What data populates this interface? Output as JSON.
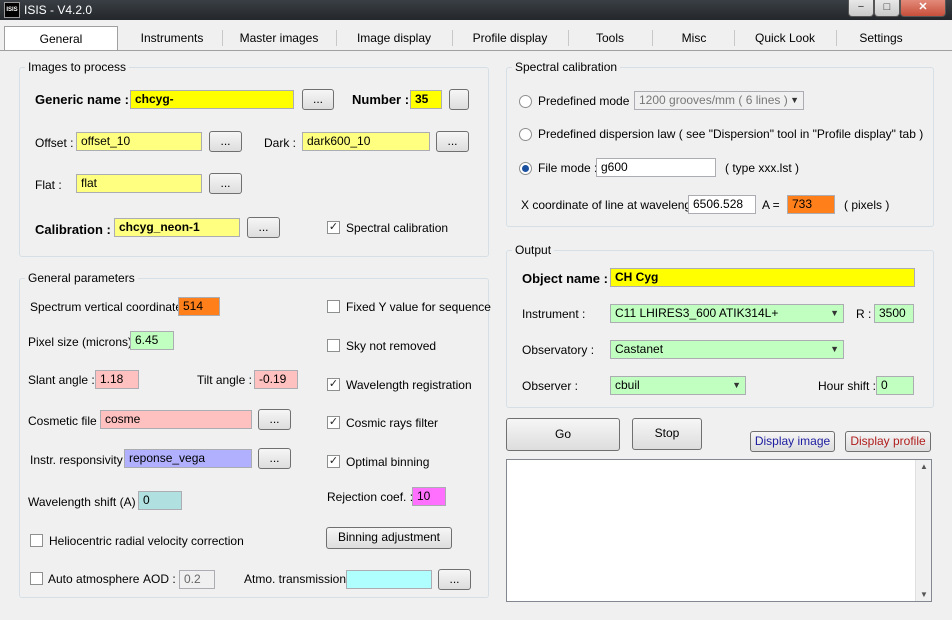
{
  "window": {
    "title": "ISIS - V4.2.0",
    "icon": "isis-icon",
    "minimize": "−",
    "maximize": "□",
    "close": "✕"
  },
  "tabs": [
    "General",
    "Instruments",
    "Master images",
    "Image display",
    "Profile display",
    "Tools",
    "Misc",
    "Quick Look",
    "Settings"
  ],
  "images": {
    "title": "Images to process",
    "generic_name_label": "Generic name :",
    "generic_name": "chcyg-",
    "number_label": "Number :",
    "number": "35",
    "offset_label": "Offset :",
    "offset": "offset_10",
    "dark_label": "Dark :",
    "dark": "dark600_10",
    "flat_label": "Flat :",
    "flat": "flat",
    "calibration_label": "Calibration :",
    "calibration": "chcyg_neon-1",
    "spectral_cal_label": "Spectral calibration",
    "browse": "..."
  },
  "general": {
    "title": "General parameters",
    "spec_vert_label": "Spectrum vertical coordinate :",
    "spec_vert": "514",
    "pixel_size_label": "Pixel size (microns) :",
    "pixel_size": "6.45",
    "slant_label": "Slant angle :",
    "slant": "1.18",
    "tilt_label": "Tilt angle :",
    "tilt": "-0.19",
    "cosmetic_label": "Cosmetic file :",
    "cosmetic": "cosme",
    "instr_resp_label": "Instr. responsivity :",
    "instr_resp": "reponse_vega",
    "wl_shift_label": "Wavelength shift (A) :",
    "wl_shift": "0",
    "helio_label": "Heliocentric radial velocity correction",
    "auto_atm_label": "Auto atmosphere",
    "aod_label": "AOD :",
    "aod": "0.2",
    "atmo_label": "Atmo. transmission :",
    "atmo": "",
    "fixed_y_label": "Fixed Y value for sequence",
    "sky_label": "Sky not removed",
    "wl_reg_label": "Wavelength registration",
    "cosmic_label": "Cosmic rays filter",
    "optimal_label": "Optimal binning",
    "rejection_label": "Rejection coef. :",
    "rejection": "10",
    "binning_button": "Binning adjustment",
    "check": "✓"
  },
  "spectral": {
    "title": "Spectral calibration",
    "predefined_mode_label": "Predefined mode",
    "predefined_mode_value": "1200 grooves/mm ( 6 lines )",
    "predefined_disp_label": "Predefined dispersion law ( see \"Dispersion\" tool in \"Profile display\" tab )",
    "file_mode_label": "File mode :",
    "file_mode": "g600",
    "file_type_hint": "( type xxx.lst )",
    "xcoord_label": "X coordinate of line at wavelength",
    "wavelength": "6506.528",
    "a_eq": "A  =",
    "pixel": "733",
    "pixels_label": "( pixels )"
  },
  "output": {
    "title": "Output",
    "object_label": "Object name :",
    "object": "CH Cyg",
    "instrument_label": "Instrument :",
    "instrument": "C11 LHIRES3_600 ATIK314L+",
    "r_label": "R :",
    "r": "3500",
    "observatory_label": "Observatory :",
    "observatory": "Castanet",
    "observer_label": "Observer :",
    "observer": "cbuil",
    "hour_shift_label": "Hour shift :",
    "hour_shift": "0",
    "dd": "▼"
  },
  "actions": {
    "go": "Go",
    "stop": "Stop",
    "display_image": "Display image",
    "display_profile": "Display profile",
    "display_image_color": "#1c1ca0",
    "display_profile_color": "#b01c1c"
  },
  "log": {
    "text": "",
    "up": "▲",
    "down": "▼"
  }
}
